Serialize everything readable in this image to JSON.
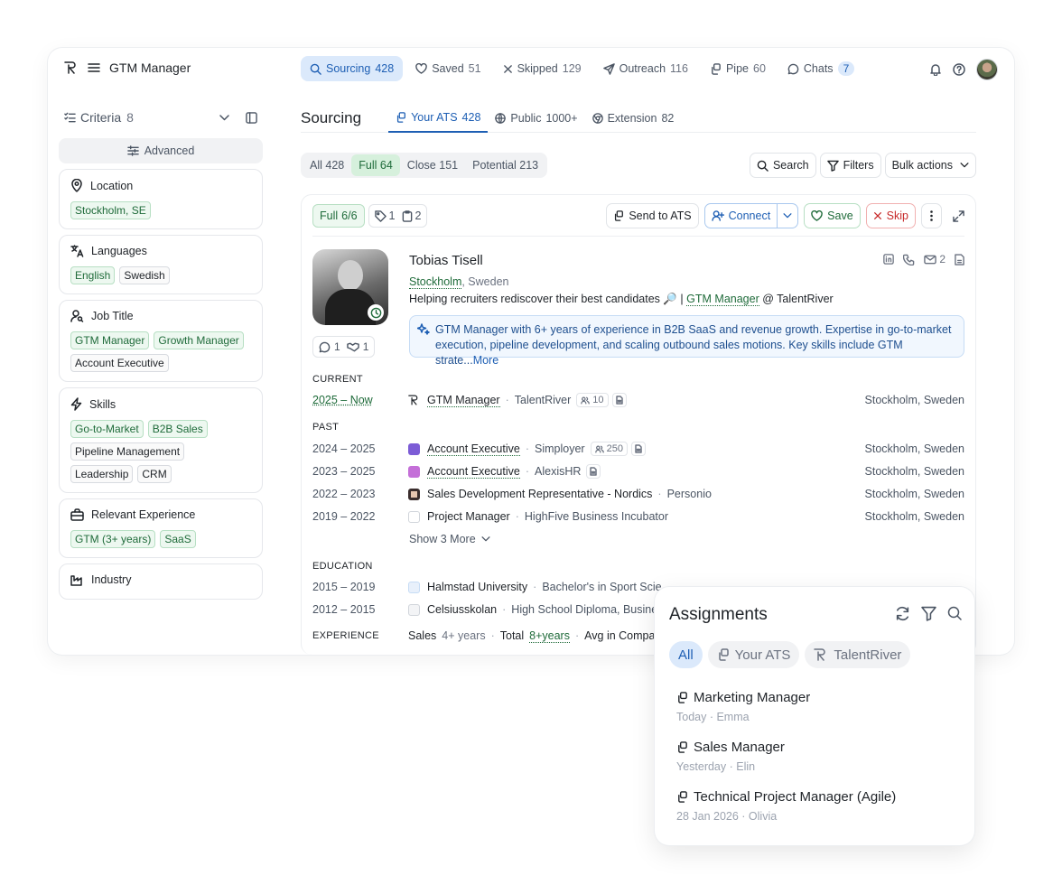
{
  "app": {
    "title": "GTM Manager"
  },
  "nav": [
    {
      "label": "Sourcing",
      "count": "428"
    },
    {
      "label": "Saved",
      "count": "51"
    },
    {
      "label": "Skipped",
      "count": "129"
    },
    {
      "label": "Outreach",
      "count": "116"
    },
    {
      "label": "Pipe",
      "count": "60"
    },
    {
      "label": "Chats",
      "count": "7"
    }
  ],
  "sidebar": {
    "criteria_label": "Criteria",
    "criteria_count": "8",
    "advanced_label": "Advanced",
    "cards": [
      {
        "title": "Location",
        "chips": [
          "Stockholm, SE"
        ]
      },
      {
        "title": "Languages",
        "chips": [
          "English",
          "Swedish"
        ]
      },
      {
        "title": "Job Title",
        "chips": [
          "GTM Manager",
          "Growth Manager",
          "Account Executive"
        ]
      },
      {
        "title": "Skills",
        "chips": [
          "Go-to-Market",
          "B2B Sales",
          "Pipeline Management",
          "Leadership",
          "CRM"
        ]
      },
      {
        "title": "Relevant Experience",
        "chips": [
          "GTM (3+ years)",
          "SaaS"
        ]
      },
      {
        "title": "Industry",
        "chips": []
      }
    ]
  },
  "main": {
    "title": "Sourcing",
    "tabs": [
      {
        "label": "Your ATS",
        "count": "428"
      },
      {
        "label": "Public",
        "count": "1000+"
      },
      {
        "label": "Extension",
        "count": "82"
      }
    ],
    "segments": [
      {
        "label": "All",
        "count": "428"
      },
      {
        "label": "Full",
        "count": "64"
      },
      {
        "label": "Close",
        "count": "151"
      },
      {
        "label": "Potential",
        "count": "213"
      }
    ],
    "search_label": "Search",
    "filters_label": "Filters",
    "bulk_label": "Bulk actions"
  },
  "profile": {
    "match_label": "Full",
    "match_value": "6/6",
    "tags_count": "1",
    "notes_count": "2",
    "send_label": "Send to ATS",
    "connect_label": "Connect",
    "save_label": "Save",
    "skip_label": "Skip",
    "comments_count": "1",
    "handshake_count": "1",
    "name": "Tobias Tisell",
    "city": "Stockholm",
    "country": ", Sweden",
    "headline_pre": "Helping recruiters rediscover their best candidates 🔎 | ",
    "headline_role": "GTM Manager",
    "headline_post": " @ TalentRiver",
    "email_count": "2",
    "summary_line1": "GTM Manager with 6+ years of experience in B2B SaaS and revenue growth. Expertise in go-to-market",
    "summary_line2": "execution, pipeline development, and scaling outbound sales motions. Key skills include GTM strate...",
    "summary_more": "More",
    "current_label": "CURRENT",
    "current": {
      "years": "2025 – Now",
      "title": "GTM Manager",
      "company": "TalentRiver",
      "employees": "10",
      "location": "Stockholm, Sweden"
    },
    "past_label": "PAST",
    "past": [
      {
        "years": "2024 – 2025",
        "title": "Account Executive",
        "company": "Simployer",
        "employees": "250",
        "location": "Stockholm, Sweden",
        "color": "#7c5cd6"
      },
      {
        "years": "2023 – 2025",
        "title": "Account Executive",
        "company": "AlexisHR",
        "employees": "",
        "location": "Stockholm, Sweden",
        "color": "#c46fd8"
      },
      {
        "years": "2022 – 2023",
        "title": "Sales Development Representative - Nordics",
        "company": "Personio",
        "employees": "",
        "location": "Stockholm, Sweden",
        "color": "#3a2d2d"
      },
      {
        "years": "2019 – 2022",
        "title": "Project Manager",
        "company": "HighFive Business Incubator",
        "employees": "",
        "location": "Stockholm, Sweden",
        "color": "#22313f"
      }
    ],
    "show_more": "Show 3 More",
    "education_label": "EDUCATION",
    "education": [
      {
        "years": "2015 – 2019",
        "school": "Halmstad University",
        "degree": "Bachelor's in Sport Scie"
      },
      {
        "years": "2012 – 2015",
        "school": "Celsiusskolan",
        "degree": "High School Diploma, Busine"
      }
    ],
    "experience_label": "EXPERIENCE",
    "experience": {
      "sales": "Sales",
      "sales_years": "4+ years",
      "total": "Total",
      "total_years": "8+years",
      "avg": "Avg in Compar"
    }
  },
  "assignments": {
    "title": "Assignments",
    "filters": [
      "All",
      "Your ATS",
      "TalentRiver"
    ],
    "items": [
      {
        "title": "Marketing Manager",
        "when": "Today",
        "who": "Emma"
      },
      {
        "title": "Sales Manager",
        "when": "Yesterday",
        "who": "Elin"
      },
      {
        "title": "Technical Project Manager (Agile)",
        "when": "28 Jan 2026",
        "who": "Olivia"
      }
    ]
  }
}
